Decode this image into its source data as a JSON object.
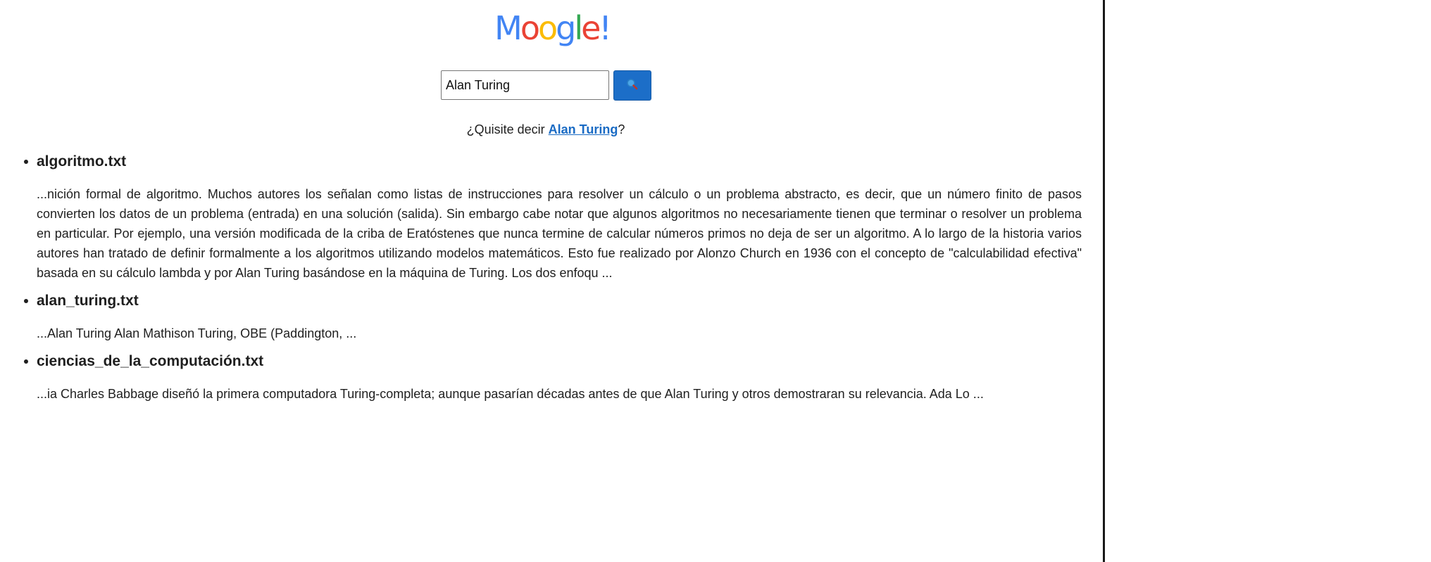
{
  "logo": {
    "letters": [
      {
        "char": "M",
        "color": "#4285f4"
      },
      {
        "char": "o",
        "color": "#ea4335"
      },
      {
        "char": "o",
        "color": "#fbbc05"
      },
      {
        "char": "g",
        "color": "#4285f4"
      },
      {
        "char": "l",
        "color": "#34a853"
      },
      {
        "char": "e",
        "color": "#ea4335"
      },
      {
        "char": "!",
        "color": "#4285f4"
      }
    ]
  },
  "search": {
    "value": "Alan Turing",
    "button_icon": "magnifier-icon"
  },
  "suggestion": {
    "prefix": "¿Quisite decir ",
    "link": "Alan Turing",
    "suffix": "?"
  },
  "results": [
    {
      "title": "algoritmo.txt",
      "snippet": "...nición formal de algoritmo. Muchos autores los señalan como listas de instrucciones para resolver un cálculo o un problema abstracto, es decir, que un número finito de pasos convierten los datos de un problema (entrada) en una solución (salida). Sin embargo cabe notar que algunos algoritmos no necesariamente tienen que terminar o resolver un problema en particular. Por ejemplo, una versión modificada de la criba de Eratóstenes que nunca termine de calcular números primos no deja de ser un algoritmo. A lo largo de la historia varios autores han tratado de definir formalmente a los algoritmos utilizando modelos matemáticos. Esto fue realizado por Alonzo Church en 1936 con el concepto de \"calculabilidad efectiva\" basada en su cálculo lambda y por Alan Turing basándose en la máquina de Turing. Los dos enfoqu ..."
    },
    {
      "title": "alan_turing.txt",
      "snippet": "...Alan Turing Alan Mathison Turing, OBE (Paddington, ..."
    },
    {
      "title": "ciencias_de_la_computación.txt",
      "snippet": "...ia Charles Babbage diseñó la primera computadora Turing-completa; aunque pasarían décadas antes de que Alan Turing y otros demostraran su relevancia. Ada Lo ..."
    }
  ]
}
